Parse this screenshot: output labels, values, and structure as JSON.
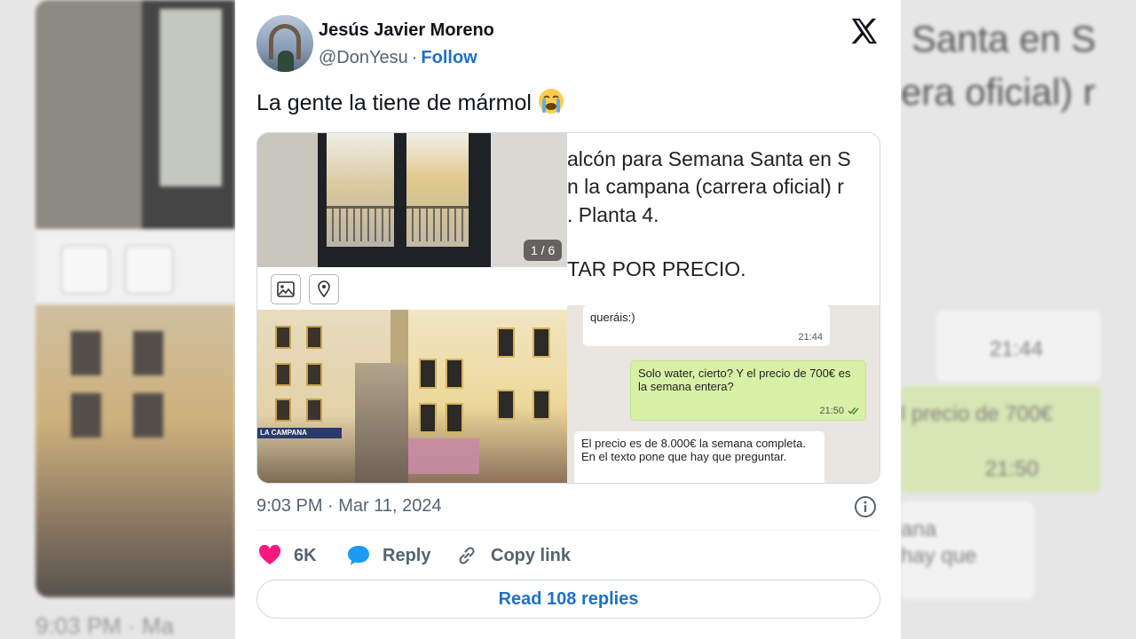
{
  "author": {
    "name": "Jesús Javier Moreno",
    "handle": "@DonYesu",
    "separator": "·",
    "follow_label": "Follow"
  },
  "tweet": {
    "text": "La gente la tiene de mármol",
    "timestamp": "9:03 PM · Mar 11, 2024"
  },
  "media": {
    "counter": "1 / 6",
    "text_image_lines": [
      "alcón para Semana Santa en S",
      "n la campana (carrera oficial) r",
      ". Planta 4.",
      "TAR POR PRECIO."
    ],
    "street_sign": "LA CAMPANA",
    "chat": [
      {
        "text": "queráis:)",
        "time": "21:44",
        "type": "received"
      },
      {
        "text": "Solo water, cierto? Y el precio de 700€ es la semana entera?",
        "time": "21:50",
        "type": "sent"
      },
      {
        "text": "El precio es de 8.000€ la semana completa. En el texto pone que hay que preguntar.",
        "time": "",
        "type": "received"
      }
    ]
  },
  "actions": {
    "like_count": "6K",
    "reply_label": "Reply",
    "copy_label": "Copy link"
  },
  "read_replies_label": "Read 108 replies",
  "background": {
    "right_line1": "Santa en S",
    "right_line2": "era oficial) r",
    "right_time1": "21:44",
    "right_price": "l precio de 700€",
    "right_time2": "21:50",
    "right_s1": "ana",
    "right_s2": "hay que",
    "left_time": "9:03 PM · Ma"
  },
  "colors": {
    "accent": "#1d72c9",
    "like": "#f91880",
    "reply": "#1d9bf0",
    "chat_sent": "#d8f1a6"
  },
  "icons": [
    "x-logo-icon",
    "crying-face-icon",
    "image-icon",
    "location-pin-icon",
    "info-icon",
    "heart-icon",
    "speech-bubble-icon",
    "link-icon",
    "double-check-icon"
  ]
}
